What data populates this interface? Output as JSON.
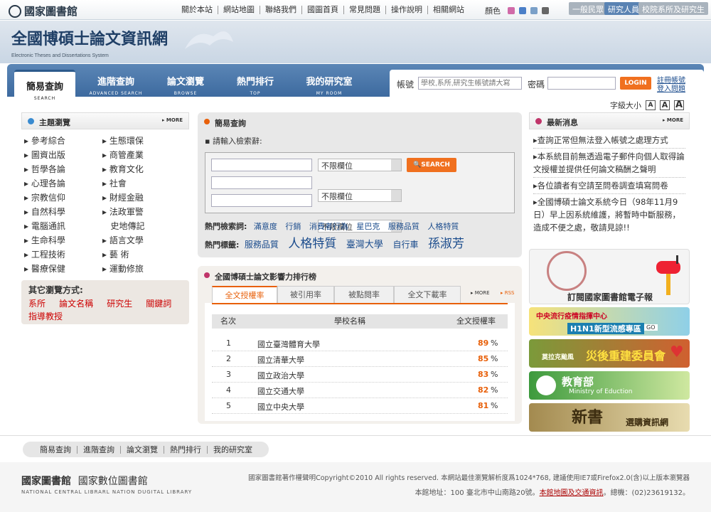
{
  "site": {
    "library_name": "國家圖書館",
    "logo_main": "全國博碩士論文資訊網",
    "logo_sub": "Electronic Theses and Dissertations System"
  },
  "toplinks": [
    "關於本站",
    "網站地圖",
    "聯絡我們",
    "國圖首頁",
    "常見問題",
    "操作說明",
    "相關網站"
  ],
  "color_label": "顏色",
  "color_swatches": [
    "#d06aa8",
    "#4b7fc8",
    "#7aa0c8",
    "#666666"
  ],
  "user_types": [
    "一般民眾",
    "研究人員",
    "校院系所及研究生"
  ],
  "tabs": [
    {
      "label": "簡易查詢",
      "sub": "SEARCH"
    },
    {
      "label": "進階查詢",
      "sub": "ADVANCED SEARCH"
    },
    {
      "label": "論文瀏覽",
      "sub": "BROWSE"
    },
    {
      "label": "熱門排行",
      "sub": "TOP"
    },
    {
      "label": "我的研究室",
      "sub": "MY ROOM"
    }
  ],
  "login": {
    "account_label": "帳號",
    "account_placeholder": "學校,系所,研究生帳號請大寫",
    "password_label": "密碼",
    "login_button": "LOGIN",
    "register": "註冊帳號",
    "login_help": "登入問題"
  },
  "font_size_label": "字級大小",
  "font_sizes": [
    "A",
    "A",
    "A"
  ],
  "subjects": {
    "title": "主題瀏覽",
    "more": "MORE",
    "col1": [
      "參考綜合",
      "圖資出版",
      "哲學各論",
      "心理各論",
      "宗教信仰",
      "自然科學",
      "電腦通訊",
      "生命科學",
      "工程技術",
      "醫療保健"
    ],
    "col2": [
      "生態環保",
      "商管產業",
      "教育文化",
      "社會",
      "財經金融",
      "法政軍警",
      "史地傳記",
      "語言文學",
      "藝 術",
      "運動修旅"
    ]
  },
  "other_browse": {
    "title": "其它瀏覽方式:",
    "links": [
      "系所",
      "論文名稱",
      "研究生",
      "關鍵詞",
      "指導教授"
    ]
  },
  "simple_search": {
    "title": "簡易查詢",
    "prompt": "請輸入檢索辭:",
    "field_option": "不限欄位",
    "search_button": "SEARCH",
    "hot_search_label": "熱門檢索詞:",
    "hot_search": [
      "滿意度",
      "行銷",
      "消費者行為",
      "星巴克",
      "服務品質",
      "人格特質"
    ],
    "hot_tag_label": "熱門標籤:",
    "hot_tags": [
      {
        "t": "服務品質",
        "s": 12
      },
      {
        "t": "人格特質",
        "s": 17
      },
      {
        "t": "臺灣大學",
        "s": 13
      },
      {
        "t": "自行車",
        "s": 12
      },
      {
        "t": "孫淑芳",
        "s": 17
      }
    ]
  },
  "ranking": {
    "title": "全國博碩士論文影響力排行榜",
    "tabs": [
      "全文授權率",
      "被引用率",
      "被點閱率",
      "全文下載率"
    ],
    "more": "MORE",
    "rss": "RSS",
    "headers": [
      "名次",
      "學校名稱",
      "全文授權率"
    ],
    "rows": [
      {
        "rank": "1",
        "school": "國立臺灣體育大學",
        "rate": "89",
        "pct": "%"
      },
      {
        "rank": "2",
        "school": "國立清華大學",
        "rate": "85",
        "pct": "%"
      },
      {
        "rank": "3",
        "school": "國立政治大學",
        "rate": "83",
        "pct": "%"
      },
      {
        "rank": "4",
        "school": "國立交通大學",
        "rate": "82",
        "pct": "%"
      },
      {
        "rank": "5",
        "school": "國立中央大學",
        "rate": "81",
        "pct": "%"
      }
    ]
  },
  "news": {
    "title": "最新消息",
    "more": "MORE",
    "items": [
      "查詢正常但無法登入帳號之處理方式",
      "本系統目前無透過電子郵件向個人取得論文授權並提供任何論文稿酬之聲明",
      "各位讀者有空請至問卷調查填寫問卷",
      "全國博碩士論文系統今日（98年11月9日）早上因系統維護，將暫時中斷服務，造成不便之處，敬請見諒!!"
    ]
  },
  "banners": {
    "epaper": "訂閱國家圖書館電子報",
    "flu_a": "中央流行疫情指揮中心",
    "flu_b": "H1N1新型流感專區",
    "flu_go": "GO",
    "typhoon_a": "莫拉克颱風",
    "typhoon_b": "災後重建委員會",
    "moe_a": "教育部",
    "moe_b": "Ministry of Eduction",
    "newbook_a": "新書",
    "newbook_b": "選購資訊網"
  },
  "footer": {
    "nav": [
      "簡易查詢",
      "進階查詢",
      "論文瀏覽",
      "熱門排行",
      "我的研究室"
    ],
    "lib1": "國家圖書館",
    "lib2": "國家數位圖書館",
    "lib_en": "NATIONAL CENTRAL LIBRARL NATION DUGITAL LIBRARY",
    "copyright": "國家圖書館著作權聲明Copyright©2010 All rights reserved. 本網站最佳瀏覽解析度爲1024*768, 建議使用IE7或Firefox2.0(含)以上版本瀏覽器",
    "address": "本館地址：100 臺北市中山南路20號。",
    "map_link": "本館地圖及交通資訊",
    "phone": "。總機：(02)23619132。"
  }
}
